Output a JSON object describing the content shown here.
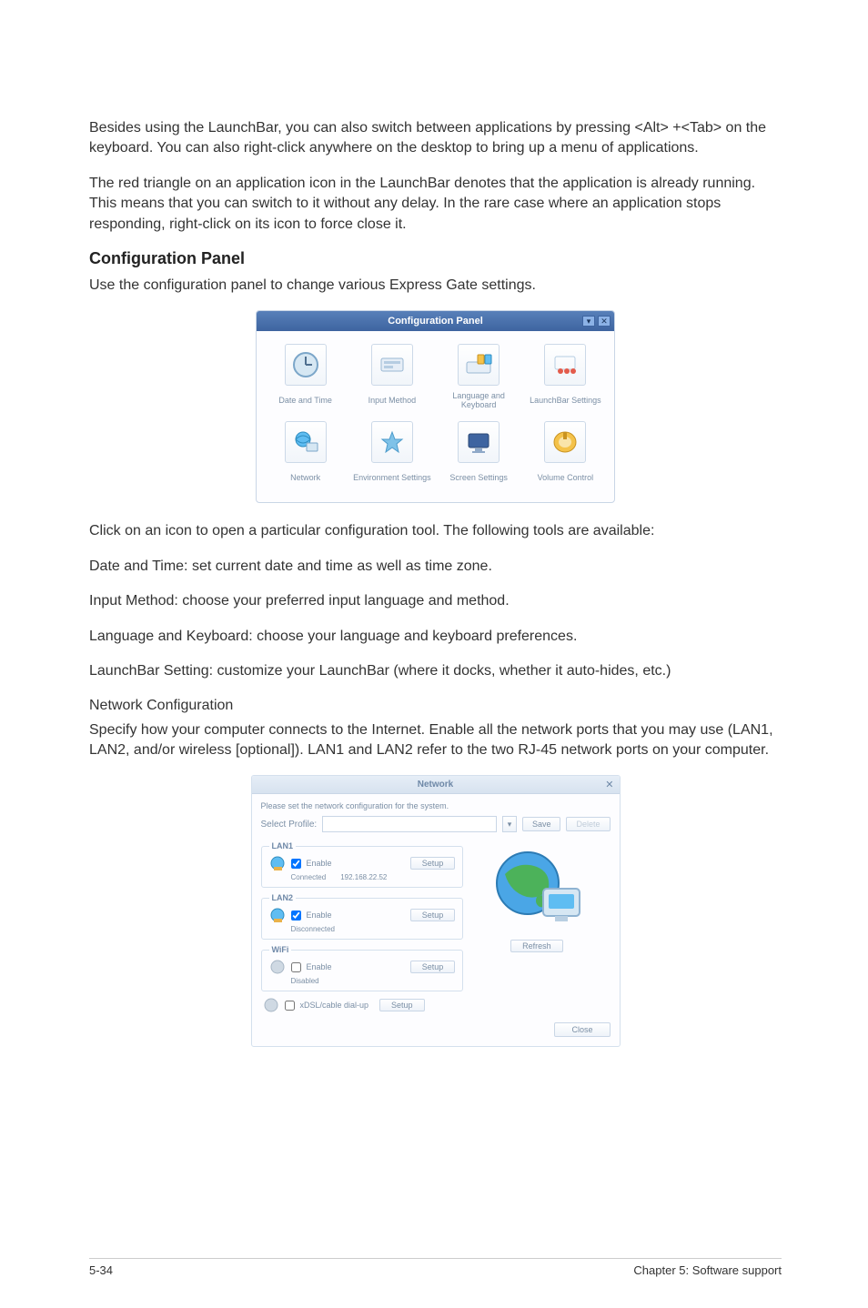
{
  "para1": "Besides using the LaunchBar, you can also switch between applications by pressing <Alt> +<Tab> on the keyboard. You can also right-click anywhere on the desktop to bring up a menu of applications.",
  "para2": "The red triangle on an application icon in the LaunchBar denotes that the application is already running. This means that you can switch to it without any delay. In the rare case where an application stops responding, right-click on its icon to force close it.",
  "heading1": "Configuration Panel",
  "para3": "Use the configuration panel to change various Express Gate settings.",
  "config_panel": {
    "title": "Configuration Panel",
    "items": [
      "Date and Time",
      "Input Method",
      "Language and Keyboard",
      "LaunchBar Settings",
      "Network",
      "Environment Settings",
      "Screen Settings",
      "Volume Control"
    ]
  },
  "para4": "Click on an icon to open a particular configuration tool. The following tools are available:",
  "para5": "Date and Time: set current date and time as well as time zone.",
  "para6": "Input Method: choose your preferred input language and method.",
  "para7": "Language and Keyboard: choose your language and keyboard preferences.",
  "para8": "LaunchBar Setting: customize your LaunchBar (where it docks, whether it auto-hides, etc.)",
  "para9a": "Network Configuration",
  "para9b": "Specify how your computer connects to the Internet. Enable all the network ports that you may use (LAN1, LAN2, and/or wireless [optional]). LAN1 and LAN2 refer to the two RJ-45 network ports on your computer.",
  "network": {
    "title": "Network",
    "helper": "Please set the network configuration for the system.",
    "profile_label": "Select Profile:",
    "save": "Save",
    "delete": "Delete",
    "enable": "Enable",
    "setup": "Setup",
    "lan1": {
      "legend": "LAN1",
      "status": "Connected",
      "ip": "192.168.22.52"
    },
    "lan2": {
      "legend": "LAN2",
      "status": "Disconnected"
    },
    "wifi": {
      "legend": "WiFi",
      "status": "Disabled"
    },
    "dialup_label": "xDSL/cable dial-up",
    "refresh": "Refresh",
    "close": "Close"
  },
  "footer": {
    "left": "5-34",
    "right": "Chapter 5: Software support"
  }
}
